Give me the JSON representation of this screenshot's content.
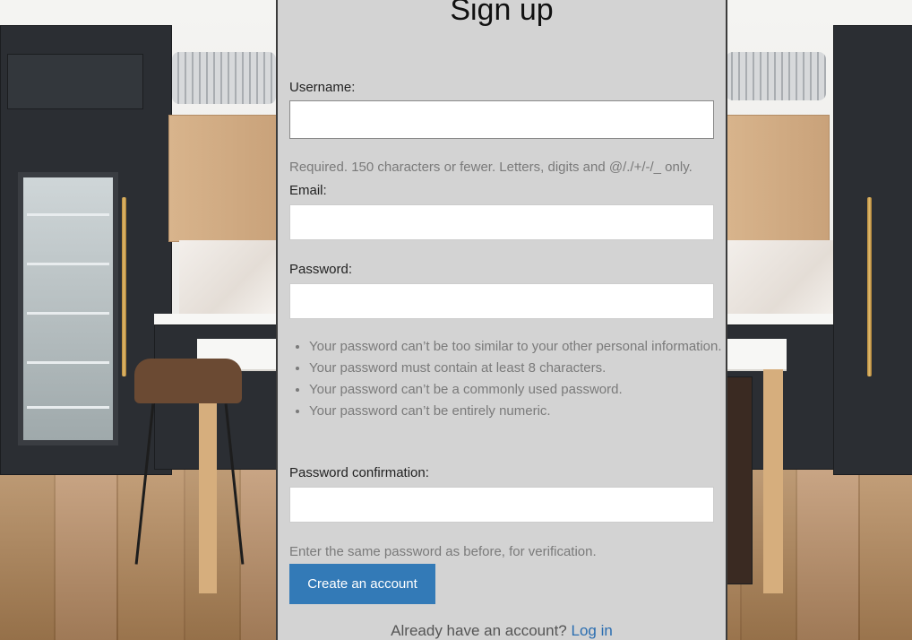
{
  "form": {
    "title": "Sign up",
    "username_label": "Username:",
    "username_value": "",
    "username_help": "Required. 150 characters or fewer. Letters, digits and @/./+/-/_ only.",
    "email_label": "Email:",
    "email_value": "",
    "password_label": "Password:",
    "password_value": "",
    "password_rules": [
      "Your password can’t be too similar to your other personal information.",
      "Your password must contain at least 8 characters.",
      "Your password can’t be a commonly used password.",
      "Your password can’t be entirely numeric."
    ],
    "password_confirm_label": "Password confirmation:",
    "password_confirm_value": "",
    "password_confirm_help": "Enter the same password as before, for verification.",
    "submit_label": "Create an account",
    "login_prompt": "Already have an account?",
    "login_link": "Log in"
  },
  "colors": {
    "panel_bg": "#d3d3d3",
    "button_bg": "#337ab7",
    "link": "#2a6db0",
    "help_text": "#7a7a7a"
  }
}
